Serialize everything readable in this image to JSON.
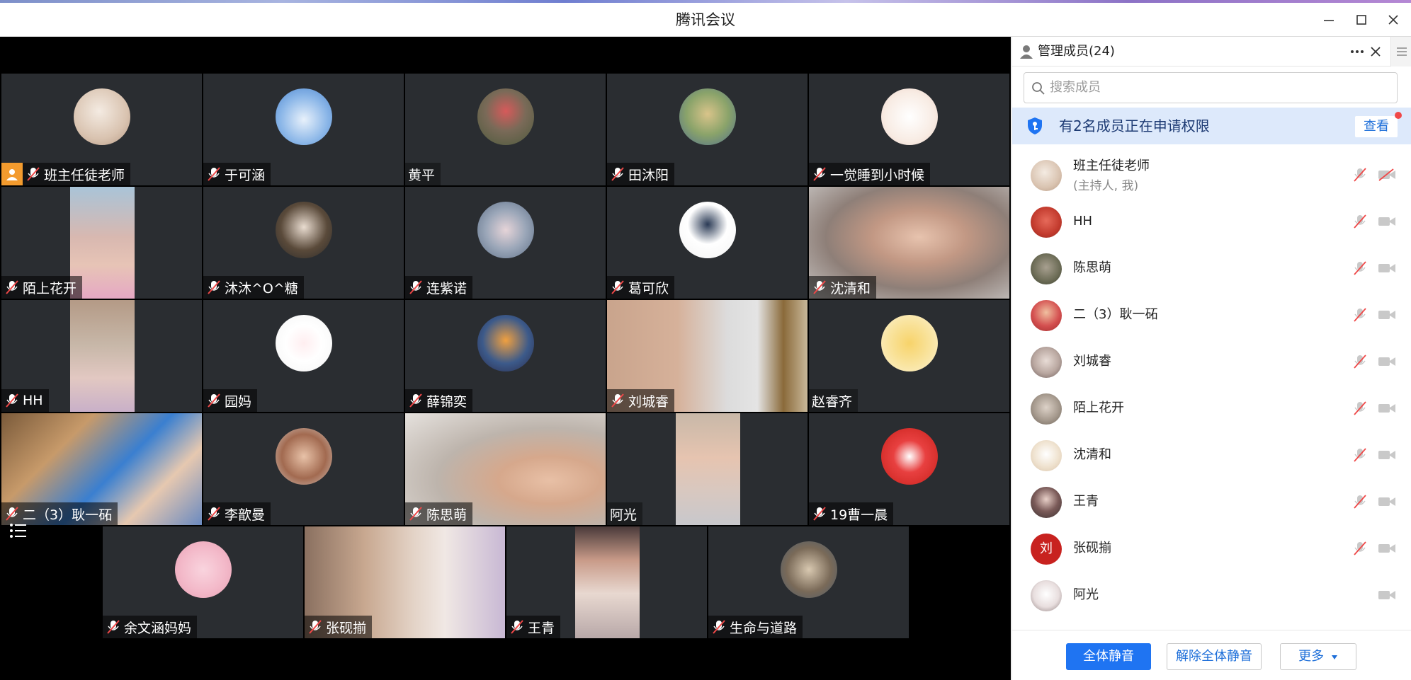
{
  "window": {
    "title": "腾讯会议"
  },
  "tiles": [
    {
      "name": "班主任徒老师",
      "host": true
    },
    {
      "name": "于可涵"
    },
    {
      "name": "黄平"
    },
    {
      "name": "田沐阳"
    },
    {
      "name": "一觉睡到小时候"
    },
    {
      "name": "陌上花开"
    },
    {
      "name": "沐沐^O^糖"
    },
    {
      "name": "连紫诺"
    },
    {
      "name": "葛可欣"
    },
    {
      "name": "沈清和"
    },
    {
      "name": "HH"
    },
    {
      "name": "园妈"
    },
    {
      "name": "薛锦奕"
    },
    {
      "name": "刘城睿"
    },
    {
      "name": "赵睿齐"
    },
    {
      "name": "二（3）耿一砳"
    },
    {
      "name": "李歆曼"
    },
    {
      "name": "陈思萌"
    },
    {
      "name": "阿光"
    },
    {
      "name": "19曹一晨"
    },
    {
      "name": "余文涵妈妈"
    },
    {
      "name": "张砚揃"
    },
    {
      "name": "王青"
    },
    {
      "name": "生命与道路"
    }
  ],
  "panel": {
    "title": "管理成员(24)",
    "search_placeholder": "搜索成员",
    "notice_text": "有2名成员正在申请权限",
    "notice_button": "查看",
    "members": [
      {
        "name": "班主任徒老师",
        "sub": "(主持人, 我)",
        "avatar_color": "#e8d6c8"
      },
      {
        "name": "HH",
        "avatar_color": "#c23a2d"
      },
      {
        "name": "陈思萌",
        "avatar_color": "#6b6b55"
      },
      {
        "name": "二（3）耿一砳",
        "avatar_color": "#d45050"
      },
      {
        "name": "刘城睿",
        "avatar_color": "#b9a7a0"
      },
      {
        "name": "陌上花开",
        "avatar_color": "#a69a8e"
      },
      {
        "name": "沈清和",
        "avatar_color": "#efe2cf"
      },
      {
        "name": "王青",
        "avatar_color": "#3a3030"
      },
      {
        "name": "张砚揃",
        "avatar_color": "#c8221f",
        "avatar_text": "刘"
      },
      {
        "name": "阿光",
        "avatar_color": "#e8dede",
        "no_mic": true
      }
    ],
    "footer": {
      "mute_all": "全体静音",
      "unmute_all": "解除全体静音",
      "more": "更多"
    }
  }
}
